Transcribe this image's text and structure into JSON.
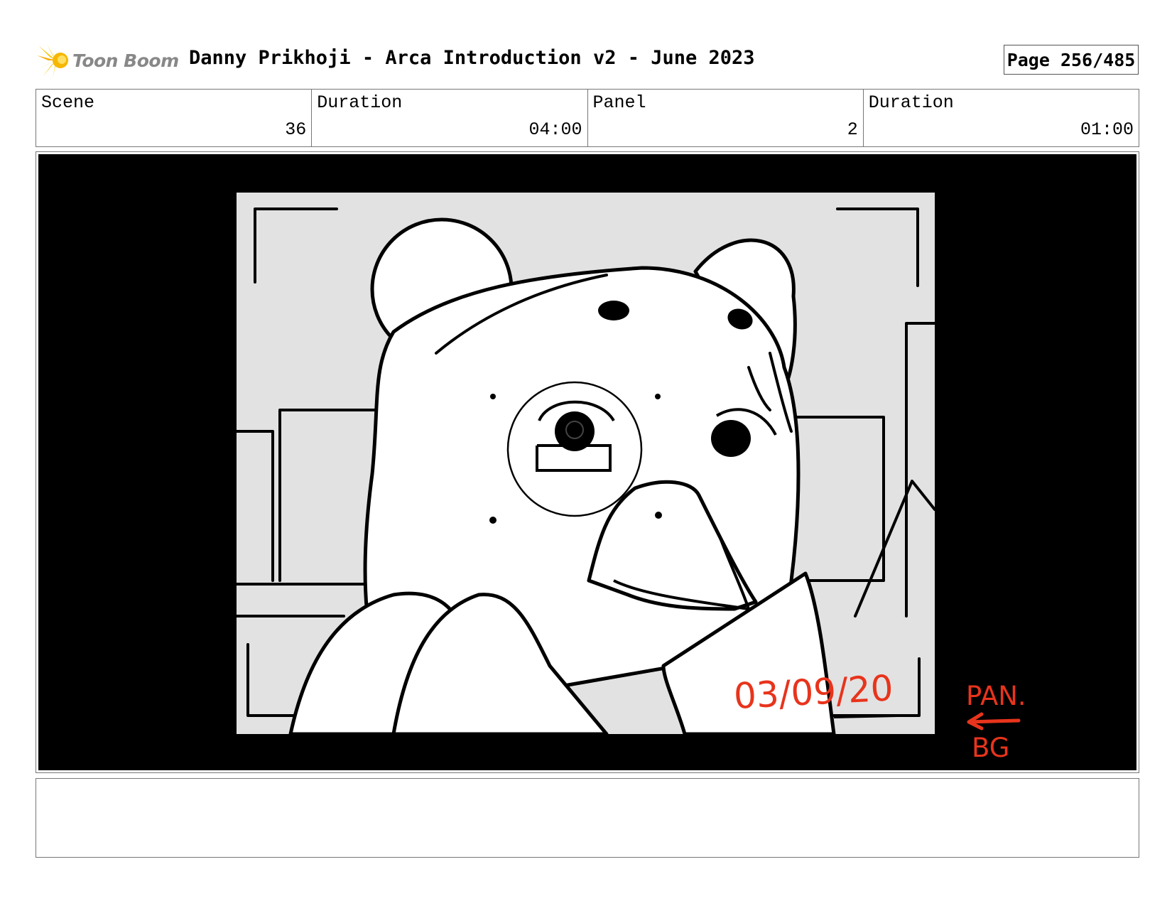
{
  "header": {
    "logo_text": "Toon Boom",
    "title": "Danny Prikhoji - Arca Introduction v2 - June 2023",
    "page_label": "Page 256/485"
  },
  "info": {
    "scene_label": "Scene",
    "scene_value": "36",
    "scene_duration_label": "Duration",
    "scene_duration_value": "04:00",
    "panel_label": "Panel",
    "panel_value": "2",
    "panel_duration_label": "Duration",
    "panel_duration_value": "01:00"
  },
  "panel": {
    "date_annotation": "03/09/20",
    "pan_note_line1": "PAN.",
    "pan_note_line2": "BG"
  },
  "colors": {
    "annotation_red": "#e8341c",
    "frame_background": "#000000",
    "sketch_background": "#e2e2e2"
  },
  "icons": [
    "toon-boom-logo-icon",
    "left-arrow-icon"
  ]
}
